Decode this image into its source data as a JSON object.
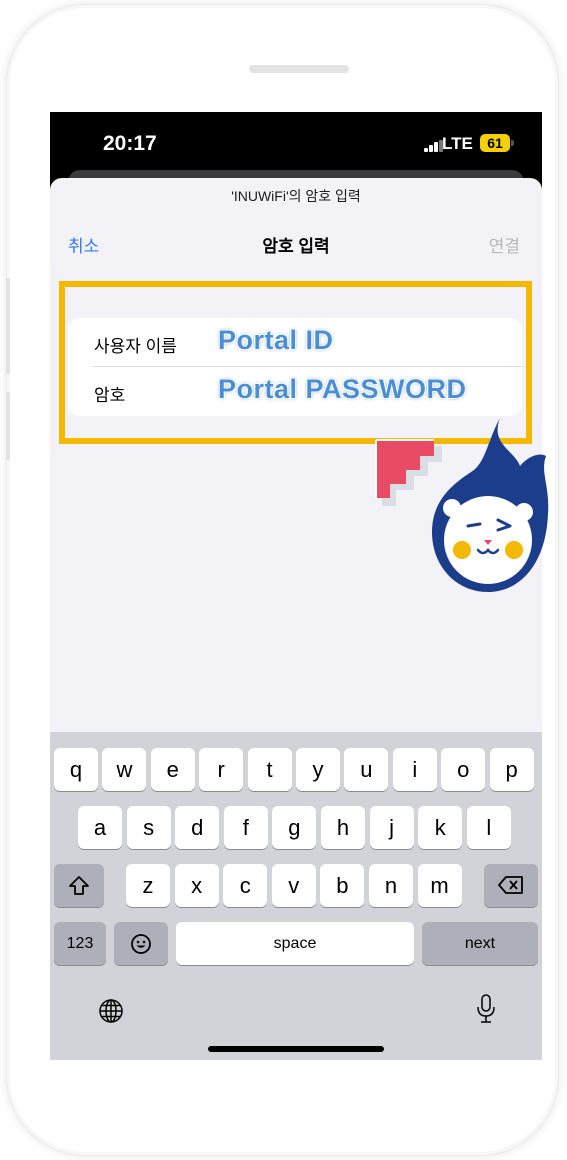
{
  "status_bar": {
    "time": "20:17",
    "network": "LTE",
    "battery": "61"
  },
  "sheet": {
    "subtitle": "'INUWiFi'의 암호 입력"
  },
  "nav": {
    "cancel": "취소",
    "title": "암호 입력",
    "connect": "연결"
  },
  "form": {
    "username_label": "사용자 이름",
    "username_value": "Portal ID",
    "password_label": "암호",
    "password_value": "Portal PASSWORD"
  },
  "keyboard": {
    "row1": [
      "q",
      "w",
      "e",
      "r",
      "t",
      "y",
      "u",
      "i",
      "o",
      "p"
    ],
    "row2": [
      "a",
      "s",
      "d",
      "f",
      "g",
      "h",
      "j",
      "k",
      "l"
    ],
    "row3": [
      "z",
      "x",
      "c",
      "v",
      "b",
      "n",
      "m"
    ],
    "numbers_key": "123",
    "space_key": "space",
    "return_key": "next"
  },
  "icons": {
    "shift": "shift-icon",
    "backspace": "backspace-icon",
    "emoji": "emoji-icon",
    "globe": "globe-icon",
    "mic": "mic-icon"
  },
  "colors": {
    "accent": "#3478f6",
    "highlight": "#f5b800",
    "overlay_text": "#4a8fd6",
    "battery": "#f5d000",
    "mascot": "#1c3d8c",
    "flag": "#e94b64"
  }
}
